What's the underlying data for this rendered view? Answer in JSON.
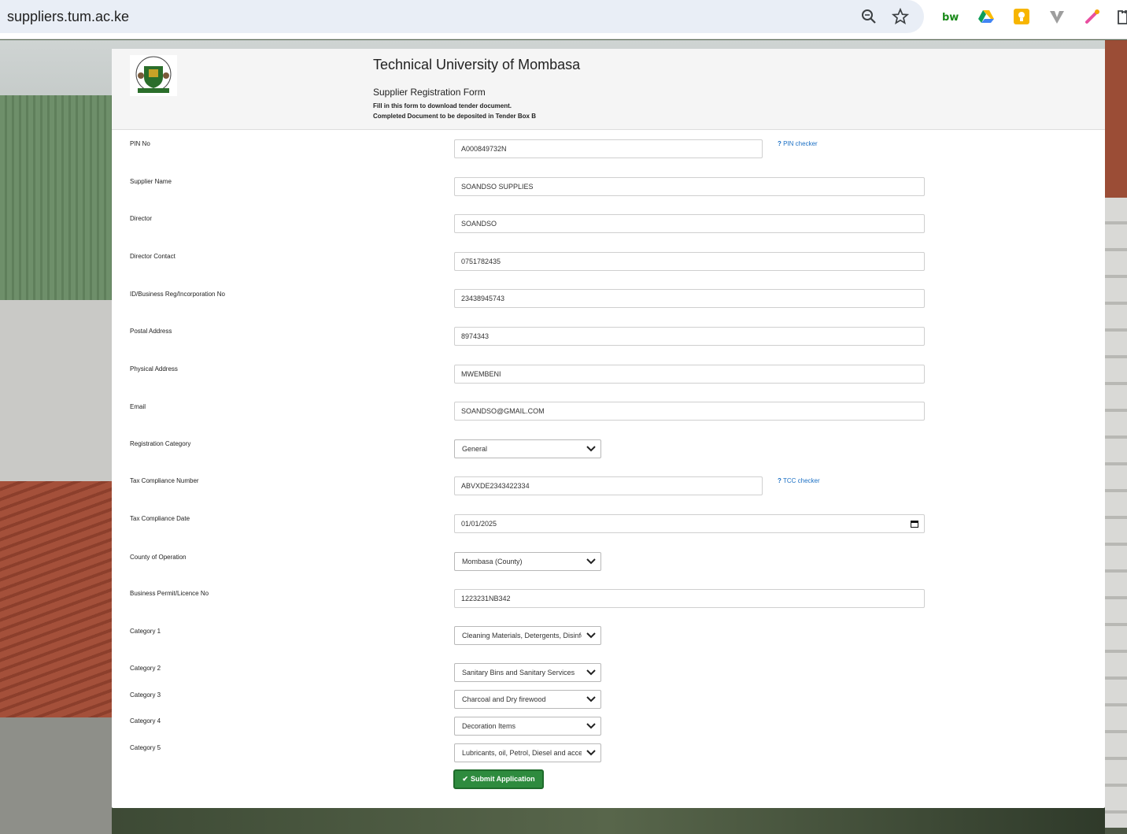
{
  "browser": {
    "url": "suppliers.tum.ac.ke",
    "extensions": [
      "bw-icon",
      "google-drive-icon",
      "keep-icon",
      "vivaldi-icon",
      "color-picker-icon",
      "extensions-puzzle-icon"
    ]
  },
  "header": {
    "title": "Technical University of Mombasa",
    "subtitle": "Supplier Registration Form",
    "note1": "Fill in this form to download tender document.",
    "note2": "Completed Document to be deposited in Tender Box B"
  },
  "form": {
    "pin": {
      "label": "PIN No",
      "value": "A000849732N",
      "checker": "PIN checker"
    },
    "supplier_name": {
      "label": "Supplier Name",
      "value": "SOANDSO SUPPLIES"
    },
    "director": {
      "label": "Director",
      "value": "SOANDSO"
    },
    "director_contact": {
      "label": "Director Contact",
      "value": "0751782435"
    },
    "id_reg": {
      "label": "ID/Business Reg/Incorporation No",
      "value": "23438945743"
    },
    "postal": {
      "label": "Postal Address",
      "value": "8974343"
    },
    "physical": {
      "label": "Physical Address",
      "value": "MWEMBENI"
    },
    "email": {
      "label": "Email",
      "value": "SOANDSO@GMAIL.COM"
    },
    "reg_category": {
      "label": "Registration Category",
      "value": "General"
    },
    "tcn": {
      "label": "Tax Compliance Number",
      "value": "ABVXDE2343422334",
      "checker": "TCC checker"
    },
    "tcd": {
      "label": "Tax Compliance Date",
      "value": "01/01/2025"
    },
    "county": {
      "label": "County of Operation",
      "value": "Mombasa (County)"
    },
    "permit": {
      "label": "Business Permit/Licence No",
      "value": "1223231NB342"
    },
    "cat1": {
      "label": "Category 1",
      "value": "Cleaning Materials, Detergents, Disinfectants"
    },
    "cat2": {
      "label": "Category 2",
      "value": "Sanitary Bins and Sanitary Services"
    },
    "cat3": {
      "label": "Category 3",
      "value": "Charcoal and Dry firewood"
    },
    "cat4": {
      "label": "Category 4",
      "value": "Decoration Items"
    },
    "cat5": {
      "label": "Category 5",
      "value": "Lubricants, oil, Petrol, Diesel and accessories"
    },
    "submit_label": "Submit Application"
  },
  "colors": {
    "submit": "#2e8b3e",
    "link": "#1a6fc4",
    "header_bg": "#f5f5f5"
  }
}
